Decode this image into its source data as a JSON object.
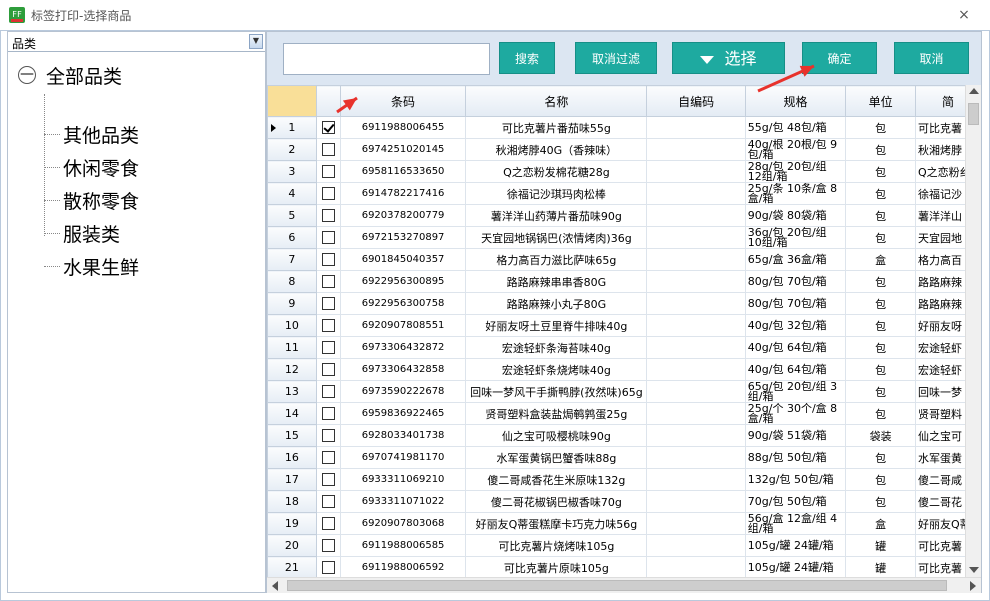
{
  "window": {
    "title": "标签打印-选择商品",
    "icon": "app-icon",
    "close_glyph": "×"
  },
  "category": {
    "combo_value": "品类",
    "root": {
      "expander": "—",
      "label": "全部品类"
    },
    "children": [
      "其他品类",
      "休闲零食",
      "散称零食",
      "服装类",
      "水果生鲜"
    ]
  },
  "toolbar": {
    "search_value": "",
    "search_label": "搜索",
    "cancel_filter_label": "取消过滤",
    "select_label": "选择",
    "confirm_label": "确定",
    "cancel_label": "取消",
    "accent": "#1eaaa0"
  },
  "grid": {
    "columns": [
      "条码",
      "名称",
      "自编码",
      "规格",
      "单位",
      "简"
    ],
    "rows": [
      {
        "n": "1",
        "checked": true,
        "code": "6911988006455",
        "name": "可比克薯片番茄味55g",
        "own": "",
        "spec": "55g/包 48包/箱",
        "unit": "包",
        "short": "可比克薯"
      },
      {
        "n": "2",
        "checked": false,
        "code": "6974251020145",
        "name": "秋湘烤脖40G（香辣味）",
        "own": "",
        "spec": "40g/根 20根/包 9包/箱",
        "unit": "包",
        "short": "秋湘烤脖"
      },
      {
        "n": "3",
        "checked": false,
        "code": "6958116533650",
        "name": "Q之恋粉发棉花糖28g",
        "own": "",
        "spec": "28g/包 20包/组 12组/箱",
        "unit": "包",
        "short": "Q之恋粉纟"
      },
      {
        "n": "4",
        "checked": false,
        "code": "6914782217416",
        "name": "徐福记沙琪玛肉松棒",
        "own": "",
        "spec": "25g/条 10条/盒 8盒/箱",
        "unit": "包",
        "short": "徐福记沙"
      },
      {
        "n": "5",
        "checked": false,
        "code": "6920378200779",
        "name": "薯洋洋山药薄片番茄味90g",
        "own": "",
        "spec": "90g/袋 80袋/箱",
        "unit": "包",
        "short": "薯洋洋山"
      },
      {
        "n": "6",
        "checked": false,
        "code": "6972153270897",
        "name": "天宜园地锅锅巴(浓情烤肉)36g",
        "own": "",
        "spec": "36g/包 20包/组 10组/箱",
        "unit": "包",
        "short": "天宜园地"
      },
      {
        "n": "7",
        "checked": false,
        "code": "6901845040357",
        "name": "格力高百力滋比萨味65g",
        "own": "",
        "spec": "65g/盒 36盒/箱",
        "unit": "盒",
        "short": "格力高百"
      },
      {
        "n": "8",
        "checked": false,
        "code": "6922956300895",
        "name": "路路麻辣串串香80G",
        "own": "",
        "spec": "80g/包 70包/箱",
        "unit": "包",
        "short": "路路麻辣"
      },
      {
        "n": "9",
        "checked": false,
        "code": "6922956300758",
        "name": "路路麻辣小丸子80G",
        "own": "",
        "spec": "80g/包 70包/箱",
        "unit": "包",
        "short": "路路麻辣"
      },
      {
        "n": "10",
        "checked": false,
        "code": "6920907808551",
        "name": "好丽友呀土豆里脊牛排味40g",
        "own": "",
        "spec": "40g/包 32包/箱",
        "unit": "包",
        "short": "好丽友呀"
      },
      {
        "n": "11",
        "checked": false,
        "code": "6973306432872",
        "name": "宏途轻虾条海苔味40g",
        "own": "",
        "spec": "40g/包 64包/箱",
        "unit": "包",
        "short": "宏途轻虾"
      },
      {
        "n": "12",
        "checked": false,
        "code": "6973306432858",
        "name": "宏途轻虾条烧烤味40g",
        "own": "",
        "spec": "40g/包 64包/箱",
        "unit": "包",
        "short": "宏途轻虾"
      },
      {
        "n": "13",
        "checked": false,
        "code": "6973590222678",
        "name": "回味一梦风干手撕鸭脖(孜然味)65g",
        "own": "",
        "spec": "65g/包 20包/组 3组/箱",
        "unit": "包",
        "short": "回味一梦"
      },
      {
        "n": "14",
        "checked": false,
        "code": "6959836922465",
        "name": "贤哥塑料盒装盐焗鹌鹑蛋25g",
        "own": "",
        "spec": "25g/个 30个/盒 8盒/箱",
        "unit": "包",
        "short": "贤哥塑料"
      },
      {
        "n": "15",
        "checked": false,
        "code": "6928033401738",
        "name": "仙之宝可吸樱桃味90g",
        "own": "",
        "spec": "90g/袋 51袋/箱",
        "unit": "袋装",
        "short": "仙之宝可"
      },
      {
        "n": "16",
        "checked": false,
        "code": "6970741981170",
        "name": "水军蛋黄锅巴蟹香味88g",
        "own": "",
        "spec": "88g/包 50包/箱",
        "unit": "包",
        "short": "水军蛋黄"
      },
      {
        "n": "17",
        "checked": false,
        "code": "6933311069210",
        "name": "傻二哥咸香花生米原味132g",
        "own": "",
        "spec": "132g/包 50包/箱",
        "unit": "包",
        "short": "傻二哥咸"
      },
      {
        "n": "18",
        "checked": false,
        "code": "6933311071022",
        "name": "傻二哥花椒锅巴椒香味70g",
        "own": "",
        "spec": "70g/包 50包/箱",
        "unit": "包",
        "short": "傻二哥花"
      },
      {
        "n": "19",
        "checked": false,
        "code": "6920907803068",
        "name": "好丽友Q蒂蛋糕摩卡巧克力味56g",
        "own": "",
        "spec": "56g/盒 12盒/组 4组/箱",
        "unit": "盒",
        "short": "好丽友Q蒂"
      },
      {
        "n": "20",
        "checked": false,
        "code": "6911988006585",
        "name": "可比克薯片烧烤味105g",
        "own": "",
        "spec": "105g/罐 24罐/箱",
        "unit": "罐",
        "short": "可比克薯"
      },
      {
        "n": "21",
        "checked": false,
        "code": "6911988006592",
        "name": "可比克薯片原味105g",
        "own": "",
        "spec": "105g/罐 24罐/箱",
        "unit": "罐",
        "short": "可比克薯"
      }
    ]
  },
  "annotation_color": "#e8322c"
}
